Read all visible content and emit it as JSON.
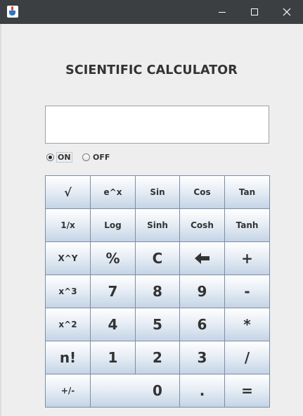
{
  "window": {
    "icon": "java-cup-icon",
    "controls": [
      "minimize-icon",
      "maximize-icon",
      "close-icon"
    ]
  },
  "heading": "SCIENTIFIC CALCULATOR",
  "display": {
    "value": ""
  },
  "power": {
    "on_label": "ON",
    "off_label": "OFF",
    "selected": "ON"
  },
  "keys": {
    "sqrt": "√",
    "exp": "e^x",
    "sin": "Sin",
    "cos": "Cos",
    "tan": "Tan",
    "recip": "1/x",
    "log": "Log",
    "sinh": "Sinh",
    "cosh": "Cosh",
    "tanh": "Tanh",
    "xpowy": "X^Y",
    "percent": "%",
    "clear": "C",
    "backspace": "🡐",
    "plus": "+",
    "cube": "x^3",
    "d7": "7",
    "d8": "8",
    "d9": "9",
    "minus": "-",
    "square": "x^2",
    "d4": "4",
    "d5": "5",
    "d6": "6",
    "multiply": "*",
    "factorial": "n!",
    "d1": "1",
    "d2": "2",
    "d3": "3",
    "divide": "/",
    "negate": "+/-",
    "d0": "0",
    "dot": ".",
    "equals": "="
  },
  "colors": {
    "titlebar": "#3c3f41",
    "background": "#eeeeee",
    "key_top": "#ffffff",
    "key_bottom": "#c4d4e6",
    "key_border": "#7c8ea3",
    "text": "#333333"
  }
}
